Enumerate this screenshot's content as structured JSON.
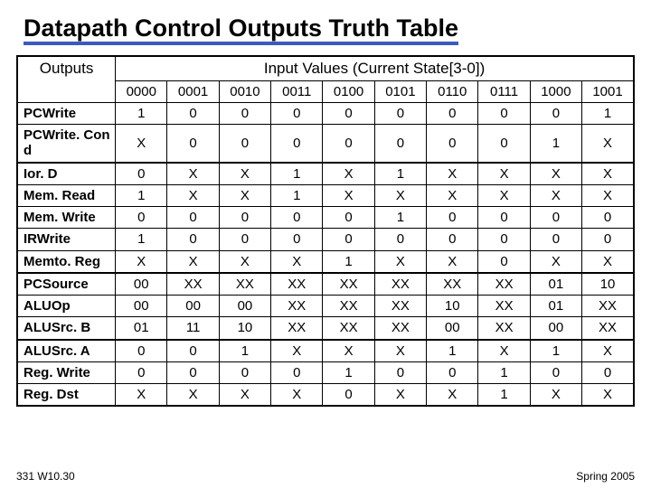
{
  "title": "Datapath Control Outputs Truth Table",
  "corner_label": "Outputs",
  "input_header": "Input Values (Current State[3-0])",
  "columns": [
    "0000",
    "0001",
    "0010",
    "0011",
    "0100",
    "0101",
    "0110",
    "0111",
    "1000",
    "1001"
  ],
  "rows": [
    {
      "label": "PCWrite",
      "vals": [
        "1",
        "0",
        "0",
        "0",
        "0",
        "0",
        "0",
        "0",
        "0",
        "1"
      ]
    },
    {
      "label": "PCWrite. Con d",
      "vals": [
        "X",
        "0",
        "0",
        "0",
        "0",
        "0",
        "0",
        "0",
        "1",
        "X"
      ]
    },
    {
      "label": "Ior. D",
      "vals": [
        "0",
        "X",
        "X",
        "1",
        "X",
        "1",
        "X",
        "X",
        "X",
        "X"
      ]
    },
    {
      "label": "Mem. Read",
      "vals": [
        "1",
        "X",
        "X",
        "1",
        "X",
        "X",
        "X",
        "X",
        "X",
        "X"
      ]
    },
    {
      "label": "Mem. Write",
      "vals": [
        "0",
        "0",
        "0",
        "0",
        "0",
        "1",
        "0",
        "0",
        "0",
        "0"
      ]
    },
    {
      "label": "IRWrite",
      "vals": [
        "1",
        "0",
        "0",
        "0",
        "0",
        "0",
        "0",
        "0",
        "0",
        "0"
      ]
    },
    {
      "label": "Memto. Reg",
      "vals": [
        "X",
        "X",
        "X",
        "X",
        "1",
        "X",
        "X",
        "0",
        "X",
        "X"
      ]
    },
    {
      "label": "PCSource",
      "vals": [
        "00",
        "XX",
        "XX",
        "XX",
        "XX",
        "XX",
        "XX",
        "XX",
        "01",
        "10"
      ]
    },
    {
      "label": "ALUOp",
      "vals": [
        "00",
        "00",
        "00",
        "XX",
        "XX",
        "XX",
        "10",
        "XX",
        "01",
        "XX"
      ]
    },
    {
      "label": "ALUSrc. B",
      "vals": [
        "01",
        "11",
        "10",
        "XX",
        "XX",
        "XX",
        "00",
        "XX",
        "00",
        "XX"
      ]
    },
    {
      "label": "ALUSrc. A",
      "vals": [
        "0",
        "0",
        "1",
        "X",
        "X",
        "X",
        "1",
        "X",
        "1",
        "X"
      ]
    },
    {
      "label": "Reg. Write",
      "vals": [
        "0",
        "0",
        "0",
        "0",
        "1",
        "0",
        "0",
        "1",
        "0",
        "0"
      ]
    },
    {
      "label": "Reg. Dst",
      "vals": [
        "X",
        "X",
        "X",
        "X",
        "0",
        "X",
        "X",
        "1",
        "X",
        "X"
      ]
    }
  ],
  "section_breaks_after": [
    1,
    6,
    9
  ],
  "footer_left": "331 W10.30",
  "footer_right": "Spring 2005",
  "chart_data": {
    "type": "table",
    "title": "Datapath Control Outputs Truth Table",
    "column_header": "Input Values (Current State[3-0])",
    "columns": [
      "0000",
      "0001",
      "0010",
      "0011",
      "0100",
      "0101",
      "0110",
      "0111",
      "1000",
      "1001"
    ],
    "rows": {
      "PCWrite": [
        "1",
        "0",
        "0",
        "0",
        "0",
        "0",
        "0",
        "0",
        "0",
        "1"
      ],
      "PCWriteCond": [
        "X",
        "0",
        "0",
        "0",
        "0",
        "0",
        "0",
        "0",
        "1",
        "X"
      ],
      "IorD": [
        "0",
        "X",
        "X",
        "1",
        "X",
        "1",
        "X",
        "X",
        "X",
        "X"
      ],
      "MemRead": [
        "1",
        "X",
        "X",
        "1",
        "X",
        "X",
        "X",
        "X",
        "X",
        "X"
      ],
      "MemWrite": [
        "0",
        "0",
        "0",
        "0",
        "0",
        "1",
        "0",
        "0",
        "0",
        "0"
      ],
      "IRWrite": [
        "1",
        "0",
        "0",
        "0",
        "0",
        "0",
        "0",
        "0",
        "0",
        "0"
      ],
      "MemtoReg": [
        "X",
        "X",
        "X",
        "X",
        "1",
        "X",
        "X",
        "0",
        "X",
        "X"
      ],
      "PCSource": [
        "00",
        "XX",
        "XX",
        "XX",
        "XX",
        "XX",
        "XX",
        "XX",
        "01",
        "10"
      ],
      "ALUOp": [
        "00",
        "00",
        "00",
        "XX",
        "XX",
        "XX",
        "10",
        "XX",
        "01",
        "XX"
      ],
      "ALUSrcB": [
        "01",
        "11",
        "10",
        "XX",
        "XX",
        "XX",
        "00",
        "XX",
        "00",
        "XX"
      ],
      "ALUSrcA": [
        "0",
        "0",
        "1",
        "X",
        "X",
        "X",
        "1",
        "X",
        "1",
        "X"
      ],
      "RegWrite": [
        "0",
        "0",
        "0",
        "0",
        "1",
        "0",
        "0",
        "1",
        "0",
        "0"
      ],
      "RegDst": [
        "X",
        "X",
        "X",
        "X",
        "0",
        "X",
        "X",
        "1",
        "X",
        "X"
      ]
    }
  }
}
